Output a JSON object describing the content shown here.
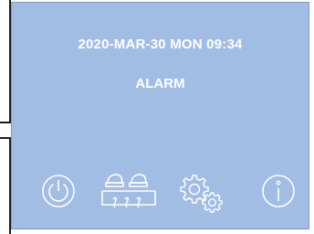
{
  "screen": {
    "datetime": "2020-MAR-30 MON 09:34",
    "status": "ALARM",
    "background_color": "#a2bde4",
    "text_color": "#ffffff"
  },
  "toolbar": {
    "buttons": [
      {
        "id": "power",
        "icon": "power-icon"
      },
      {
        "id": "heater",
        "icon": "heater-icon"
      },
      {
        "id": "settings",
        "icon": "gears-icon"
      },
      {
        "id": "info",
        "icon": "info-icon"
      }
    ]
  }
}
